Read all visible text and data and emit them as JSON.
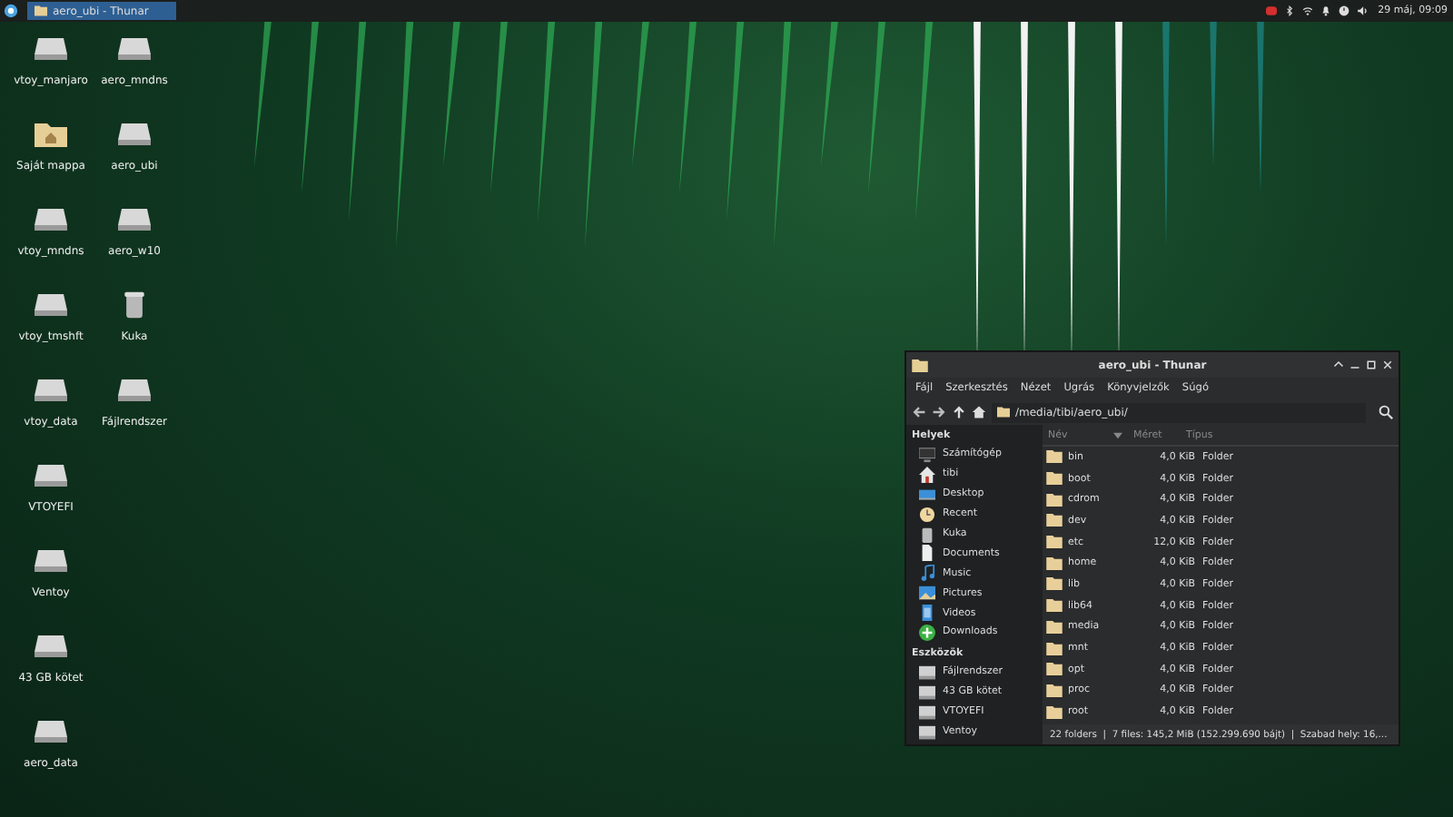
{
  "taskbar": {
    "task": {
      "title": "aero_ubi - Thunar",
      "selected": true
    },
    "clock": "29 máj, 09:09"
  },
  "desktop_icons": [
    {
      "label": "vtoy_manjaro",
      "kind": "drive"
    },
    {
      "label": "Saját mappa",
      "kind": "home"
    },
    {
      "label": "vtoy_mndns",
      "kind": "drive"
    },
    {
      "label": "vtoy_tmshft",
      "kind": "drive"
    },
    {
      "label": "vtoy_data",
      "kind": "drive"
    },
    {
      "label": "VTOYEFI",
      "kind": "drive"
    },
    {
      "label": "Ventoy",
      "kind": "drive"
    },
    {
      "label": "43 GB kötet",
      "kind": "drive"
    },
    {
      "label": "aero_data",
      "kind": "drive"
    },
    {
      "label": "aero_mndns",
      "kind": "drive"
    },
    {
      "label": "aero_ubi",
      "kind": "drive"
    },
    {
      "label": "aero_w10",
      "kind": "drive"
    },
    {
      "label": "Kuka",
      "kind": "trash"
    },
    {
      "label": "Fájlrendszer",
      "kind": "drive"
    }
  ],
  "window": {
    "title": "aero_ubi - Thunar",
    "menu": [
      "Fájl",
      "Szerkesztés",
      "Nézet",
      "Ugrás",
      "Könyvjelzők",
      "Súgó"
    ],
    "path": "/media/tibi/aero_ubi/",
    "sidebar": [
      {
        "heading": "Helyek",
        "items": [
          {
            "label": "Számítógép",
            "kind": "computer"
          },
          {
            "label": "tibi",
            "kind": "home"
          },
          {
            "label": "Desktop",
            "kind": "desktop"
          },
          {
            "label": "Recent",
            "kind": "recent"
          },
          {
            "label": "Kuka",
            "kind": "trash"
          },
          {
            "label": "Documents",
            "kind": "document"
          },
          {
            "label": "Music",
            "kind": "music"
          },
          {
            "label": "Pictures",
            "kind": "pictures"
          },
          {
            "label": "Videos",
            "kind": "videos"
          },
          {
            "label": "Downloads",
            "kind": "downloads"
          }
        ]
      },
      {
        "heading": "Eszközök",
        "items": [
          {
            "label": "Fájlrendszer",
            "kind": "drive"
          },
          {
            "label": "43 GB kötet",
            "kind": "drive"
          },
          {
            "label": "VTOYEFI",
            "kind": "drive"
          },
          {
            "label": "Ventoy",
            "kind": "drive"
          }
        ]
      }
    ],
    "columns": [
      "Név",
      "Méret",
      "Típus"
    ],
    "rows": [
      {
        "name": "bin",
        "size": "4,0 KiB",
        "type": "Folder"
      },
      {
        "name": "boot",
        "size": "4,0 KiB",
        "type": "Folder"
      },
      {
        "name": "cdrom",
        "size": "4,0 KiB",
        "type": "Folder"
      },
      {
        "name": "dev",
        "size": "4,0 KiB",
        "type": "Folder"
      },
      {
        "name": "etc",
        "size": "12,0 KiB",
        "type": "Folder"
      },
      {
        "name": "home",
        "size": "4,0 KiB",
        "type": "Folder"
      },
      {
        "name": "lib",
        "size": "4,0 KiB",
        "type": "Folder"
      },
      {
        "name": "lib64",
        "size": "4,0 KiB",
        "type": "Folder"
      },
      {
        "name": "media",
        "size": "4,0 KiB",
        "type": "Folder"
      },
      {
        "name": "mnt",
        "size": "4,0 KiB",
        "type": "Folder"
      },
      {
        "name": "opt",
        "size": "4,0 KiB",
        "type": "Folder"
      },
      {
        "name": "proc",
        "size": "4,0 KiB",
        "type": "Folder"
      },
      {
        "name": "root",
        "size": "4,0 KiB",
        "type": "Folder"
      }
    ],
    "status": "22 folders  |  7 files: 145,2 MiB (152.299.690 bájt)  |  Szabad hely: 16,..."
  }
}
